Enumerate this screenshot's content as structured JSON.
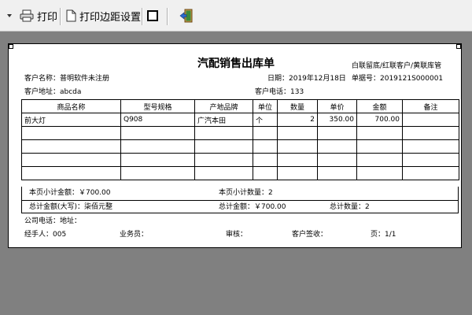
{
  "toolbar": {
    "print_label": "打印",
    "margin_label": "打印边距设置",
    "icons": [
      "chevron-down-icon",
      "printer-icon",
      "page-icon",
      "window-icon",
      "exit-door-icon"
    ]
  },
  "doc": {
    "title": "汽配销售出库单",
    "copy_note": "白联留底/红联客户/黄联库管",
    "customer_name": "客户名称：普明软件未注册",
    "date": "日期：2019年12月18日",
    "order_no": "单据号：2019121S000001",
    "customer_address": "客户地址：abcda",
    "customer_phone": "客户电话：133",
    "columns": [
      "商品名称",
      "型号规格",
      "产地品牌",
      "单位",
      "数量",
      "单价",
      "金额",
      "备注"
    ],
    "rows": [
      [
        "前大灯",
        "Q908",
        "广汽本田",
        "个",
        "2",
        "350.00",
        "700.00",
        ""
      ],
      [
        "",
        "",
        "",
        "",
        "",
        "",
        "",
        ""
      ],
      [
        "",
        "",
        "",
        "",
        "",
        "",
        "",
        ""
      ],
      [
        "",
        "",
        "",
        "",
        "",
        "",
        "",
        ""
      ],
      [
        "",
        "",
        "",
        "",
        "",
        "",
        "",
        ""
      ]
    ],
    "page_subtotal_amount": "本页小计金额：￥700.00",
    "page_subtotal_qty": "本页小计数量：2",
    "total_amount_upper": "总计金额(大写)：柒佰元整",
    "total_amount": "总计金额：￥700.00",
    "total_qty": "总计数量：2",
    "company": "公司电话：地址：",
    "handler": "经手人：005",
    "salesman": "业务员：",
    "reviewer": "审核：",
    "customer_sign": "客户签收：",
    "page": "页：1/1"
  }
}
